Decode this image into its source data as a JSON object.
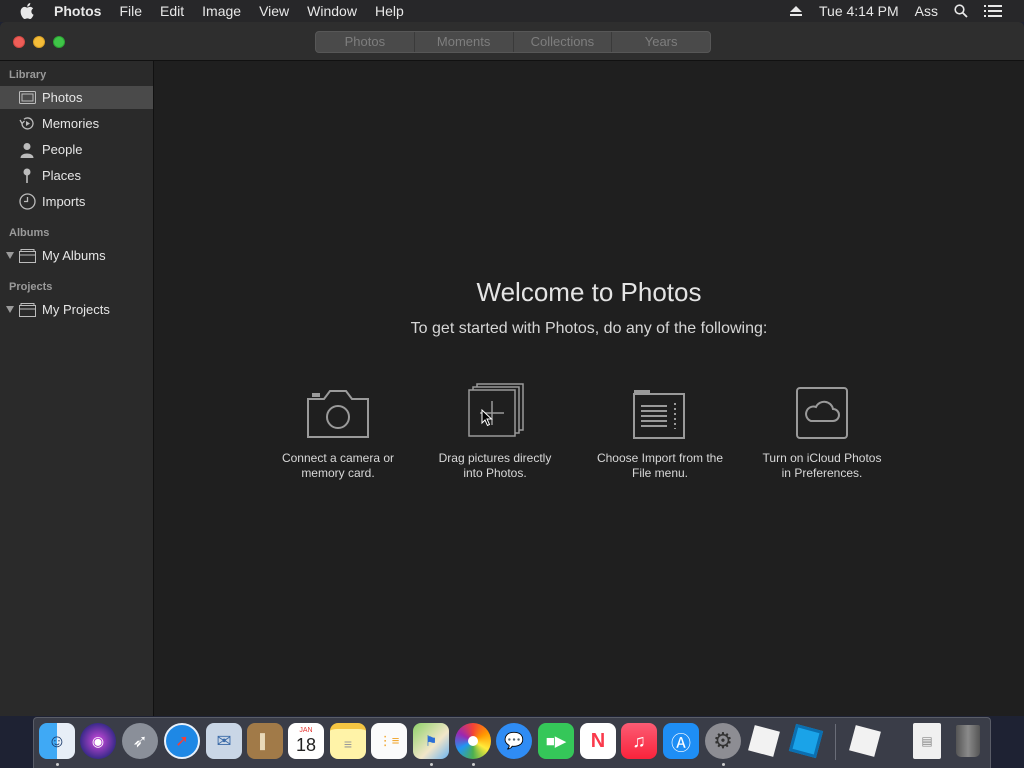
{
  "menubar": {
    "app_name": "Photos",
    "menus": [
      "File",
      "Edit",
      "Image",
      "View",
      "Window",
      "Help"
    ],
    "clock": "Tue 4:14 PM",
    "user": "Ass",
    "icons": [
      "apple-icon",
      "eject-icon",
      "search-icon",
      "list-icon"
    ]
  },
  "toolbar": {
    "tabs": [
      "Photos",
      "Moments",
      "Collections",
      "Years"
    ]
  },
  "sidebar": {
    "library_header": "Library",
    "library_items": [
      {
        "label": "Photos",
        "icon": "photos-icon",
        "selected": true
      },
      {
        "label": "Memories",
        "icon": "memories-icon"
      },
      {
        "label": "People",
        "icon": "person-icon"
      },
      {
        "label": "Places",
        "icon": "pin-icon"
      },
      {
        "label": "Imports",
        "icon": "clock-icon"
      }
    ],
    "albums_header": "Albums",
    "albums_item": "My Albums",
    "projects_header": "Projects",
    "projects_item": "My Projects"
  },
  "content": {
    "title": "Welcome to Photos",
    "subtitle": "To get started with Photos, do any of the following:",
    "options": [
      {
        "line1": "Connect a camera or",
        "line2": "memory card.",
        "icon": "camera-icon"
      },
      {
        "line1": "Drag pictures directly",
        "line2": "into Photos.",
        "icon": "add-photos-icon"
      },
      {
        "line1": "Choose Import from the",
        "line2": "File menu.",
        "icon": "import-icon"
      },
      {
        "line1": "Turn on iCloud Photos",
        "line2": "in Preferences.",
        "icon": "cloud-icon"
      }
    ]
  },
  "dock": {
    "calendar_month": "JAN",
    "calendar_day": "18",
    "apps": [
      "Finder",
      "Siri",
      "Launchpad",
      "Safari",
      "Mail",
      "Contacts",
      "Calendar",
      "Notes",
      "Reminders",
      "Maps",
      "Photos",
      "Messages",
      "FaceTime",
      "News",
      "Music",
      "App Store",
      "System Preferences",
      "Roblox",
      "Roblox Studio",
      "Roblox",
      "Downloads",
      "Trash"
    ]
  },
  "colors": {
    "window_bg": "#1f1f1f",
    "sidebar_bg": "#2a2a2a",
    "selected_bg": "#4a4a4a",
    "text": "#e6e6e6"
  }
}
